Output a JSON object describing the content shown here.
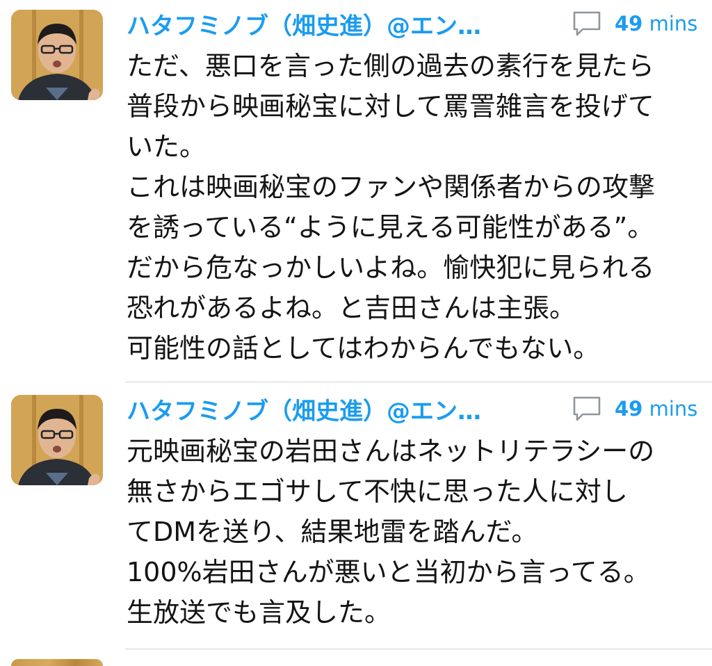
{
  "tweets": [
    {
      "author": "ハタフミノブ（畑史進）@エン…",
      "time_num": "49",
      "time_unit": "mins",
      "lines": [
        "ただ、悪口を言った側の過去の素行を見たら",
        "普段から映画秘宝に対して罵詈雑言を投げて",
        "いた。",
        "これは映画秘宝のファンや関係者からの攻撃",
        "を誘っている“ように見える可能性がある”。",
        "だから危なっかしいよね。愉快犯に見られる",
        "恐れがあるよね。と吉田さんは主張。",
        "可能性の話としてはわからんでもない。"
      ]
    },
    {
      "author": "ハタフミノブ（畑史進）@エン…",
      "time_num": "49",
      "time_unit": "mins",
      "lines": [
        "元映画秘宝の岩田さんはネットリテラシーの",
        "無さからエゴサして不快に思った人に対し",
        "てDMを送り、結果地雷を踏んだ。",
        "100%岩田さんが悪いと当初から言ってる。",
        "生放送でも言及した。"
      ]
    }
  ],
  "icons": {
    "reply": "speech-bubble-icon",
    "avatar": "user-avatar"
  },
  "colors": {
    "accent": "#1a9cf0",
    "text": "#141414",
    "divider": "#cfd3d8"
  }
}
